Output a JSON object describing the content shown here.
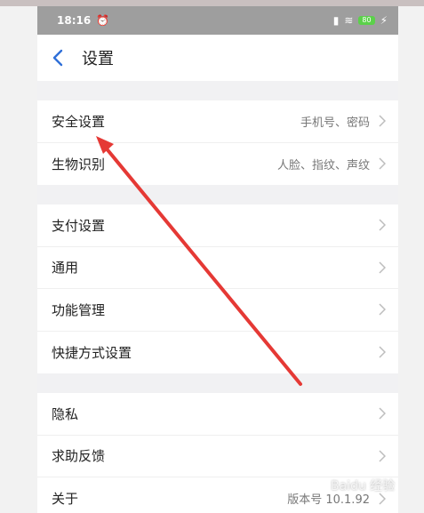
{
  "status": {
    "time": "18:16",
    "battery": "80"
  },
  "nav": {
    "title": "设置"
  },
  "groups": [
    {
      "items": [
        {
          "label": "安全设置",
          "value": "手机号、密码"
        },
        {
          "label": "生物识别",
          "value": "人脸、指纹、声纹"
        }
      ]
    },
    {
      "items": [
        {
          "label": "支付设置",
          "value": ""
        },
        {
          "label": "通用",
          "value": ""
        },
        {
          "label": "功能管理",
          "value": ""
        },
        {
          "label": "快捷方式设置",
          "value": ""
        }
      ]
    },
    {
      "items": [
        {
          "label": "隐私",
          "value": ""
        },
        {
          "label": "求助反馈",
          "value": ""
        },
        {
          "label": "关于",
          "value": "版本号 10.1.92"
        }
      ]
    }
  ],
  "watermark": "Baidu 经验",
  "colors": {
    "accent": "#2f6fd8",
    "annotation_arrow": "#e53935"
  }
}
